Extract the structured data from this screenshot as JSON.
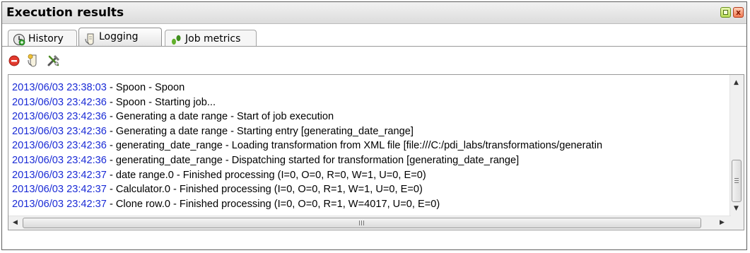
{
  "panel": {
    "title": "Execution results"
  },
  "window_controls": {
    "maximize_icon": "maximize-icon",
    "close_label": "x"
  },
  "tabs": [
    {
      "label": "History",
      "icon": "history-icon",
      "active": false
    },
    {
      "label": "Logging",
      "icon": "logging-icon",
      "active": true
    },
    {
      "label": "Job metrics",
      "icon": "job-metrics-icon",
      "active": false
    }
  ],
  "toolbar": [
    {
      "icon": "stop-icon"
    },
    {
      "icon": "clear-log-icon"
    },
    {
      "icon": "settings-icon"
    }
  ],
  "log": {
    "lines": [
      {
        "timestamp": "2013/06/03 23:38:03",
        "message": " - Spoon - Spoon"
      },
      {
        "timestamp": "2013/06/03 23:42:36",
        "message": " - Spoon - Starting job..."
      },
      {
        "timestamp": "2013/06/03 23:42:36",
        "message": " - Generating a date range - Start of job execution"
      },
      {
        "timestamp": "2013/06/03 23:42:36",
        "message": " - Generating a date range - Starting entry [generating_date_range]"
      },
      {
        "timestamp": "2013/06/03 23:42:36",
        "message": " - generating_date_range - Loading transformation from XML file [file:///C:/pdi_labs/transformations/generatin"
      },
      {
        "timestamp": "2013/06/03 23:42:36",
        "message": " - generating_date_range - Dispatching started for transformation [generating_date_range]"
      },
      {
        "timestamp": "2013/06/03 23:42:37",
        "message": " - date range.0 - Finished processing (I=0, O=0, R=0, W=1, U=0, E=0)"
      },
      {
        "timestamp": "2013/06/03 23:42:37",
        "message": " - Calculator.0 - Finished processing (I=0, O=0, R=1, W=1, U=0, E=0)"
      },
      {
        "timestamp": "2013/06/03 23:42:37",
        "message": " - Clone row.0 - Finished processing (I=0, O=0, R=1, W=4017, U=0, E=0)"
      }
    ]
  },
  "colors": {
    "timestamp": "#1a2bd6",
    "text": "#000000"
  }
}
